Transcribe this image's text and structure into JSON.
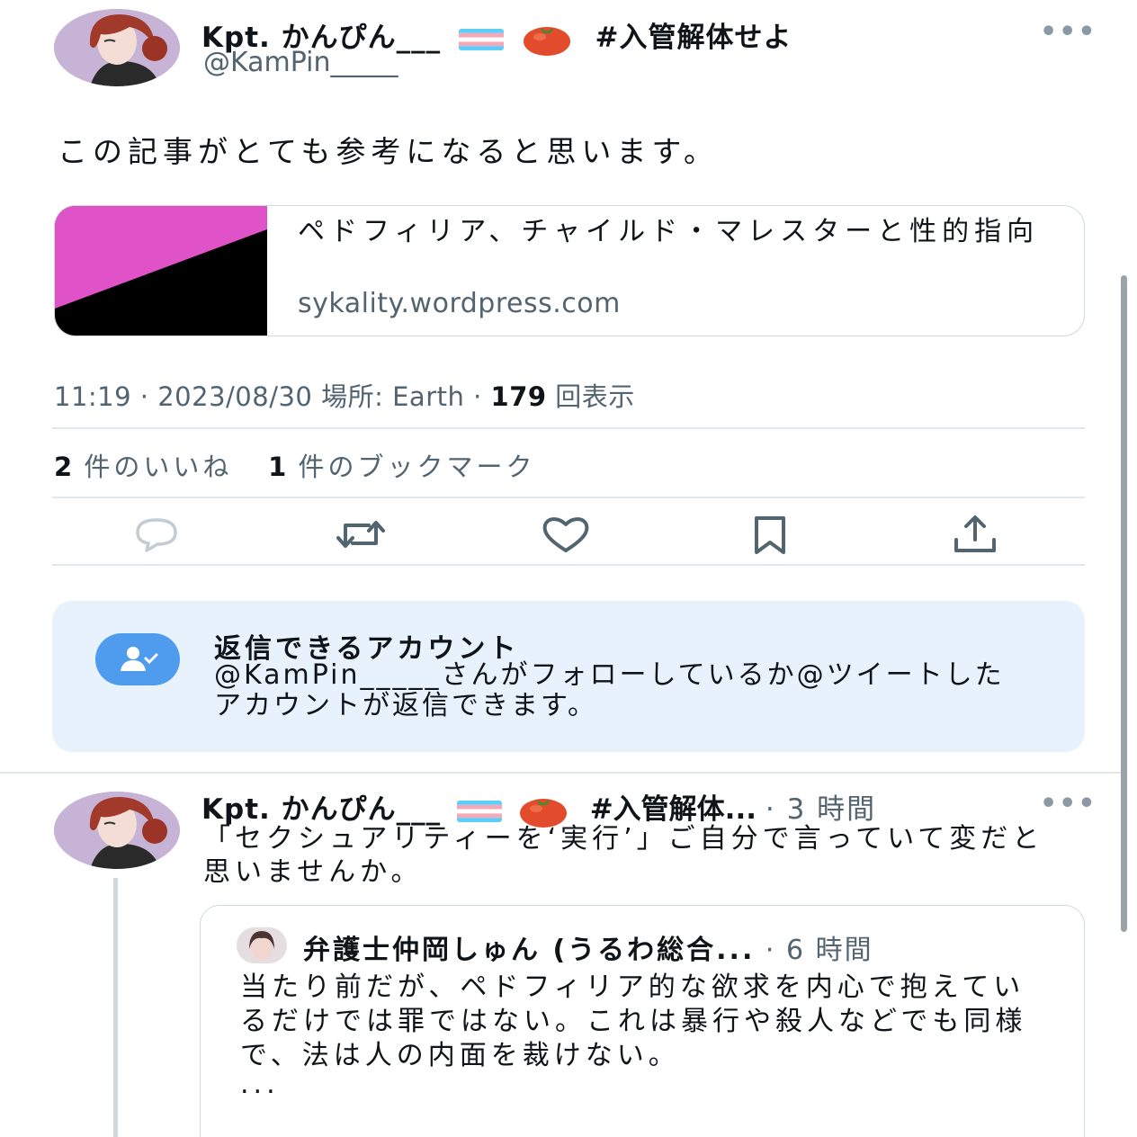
{
  "tweet": {
    "author": {
      "display_name": "Kpt. かんぴん___",
      "hashtag": "#入管解体せよ",
      "handle": "@KamPin_____",
      "flag_icon": "transgender-flag-icon",
      "emoji_icon": "tomato-icon"
    },
    "more_label": "•••",
    "text": "この記事がとても参考になると思います。",
    "link_card": {
      "title": "ペドフィリア、チャイルド・マレスターと性的指向",
      "domain": "sykality.wordpress.com"
    },
    "meta": {
      "time": "11:19",
      "sep1": " · ",
      "date": "2023/08/30",
      "location": " 場所: Earth",
      "sep2": " · ",
      "views_count": "179",
      "views_label": " 回表示"
    },
    "stats": {
      "likes_count": "2",
      "likes_label": " 件のいいね",
      "bookmarks_count": "1",
      "bookmarks_label": " 件のブックマーク"
    },
    "actions": [
      "reply-icon",
      "retweet-icon",
      "like-icon",
      "bookmark-icon",
      "share-icon"
    ]
  },
  "reply_notice": {
    "title": "返信できるアカウント",
    "body": "@KamPin_____さんがフォローしているか@ツイートしたアカウントが返信できます。"
  },
  "reply": {
    "display_name": "Kpt. かんぴん___",
    "hashtag": "#入管解体...",
    "time": "· 3 時間",
    "more_label": "•••",
    "text": "「セクシュアリティーを‘実行’」ご自分で言っていて変だと思いませんか。",
    "quote": {
      "author": "弁護士仲岡しゅん (うるわ総合...",
      "time": " · 6 時間",
      "text": "当たり前だが、ペドフィリア的な欲求を内心で抱えているだけでは罪ではない。これは暴行や殺人などでも同様で、法は人の内面を裁けない。",
      "ellipsis": "..."
    }
  },
  "colors": {
    "text_primary": "#0f1419",
    "text_secondary": "#536471",
    "notice_bg": "#e8f2fc",
    "accent_blue": "#4f9cef",
    "card_pink": "#e052c8",
    "border": "#cfd9de"
  }
}
